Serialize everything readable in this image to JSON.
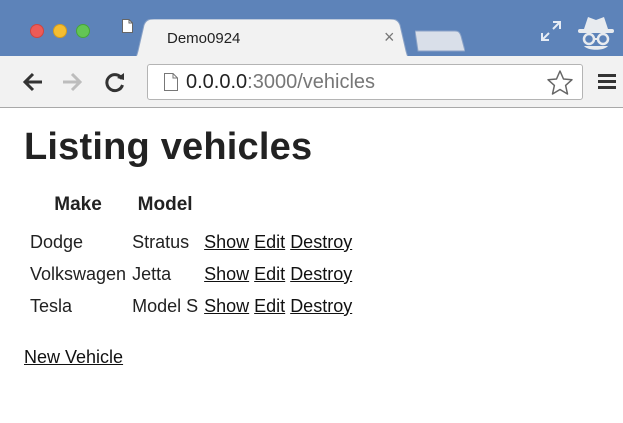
{
  "tab": {
    "title": "Demo0924",
    "close": "×"
  },
  "address_bar": {
    "host": "0.0.0.0",
    "rest": ":3000/vehicles"
  },
  "page": {
    "title": "Listing vehicles",
    "table": {
      "headers": [
        "Make",
        "Model"
      ],
      "rows": [
        {
          "make": "Dodge",
          "model": "Stratus",
          "show": "Show",
          "edit": "Edit",
          "destroy": "Destroy"
        },
        {
          "make": "Volkswagen",
          "model": "Jetta",
          "show": "Show",
          "edit": "Edit",
          "destroy": "Destroy"
        },
        {
          "make": "Tesla",
          "model": "Model S",
          "show": "Show",
          "edit": "Edit",
          "destroy": "Destroy"
        }
      ]
    },
    "new_link": "New Vehicle"
  },
  "icons": [
    "close-window-icon",
    "minimize-window-icon",
    "maximize-window-icon",
    "page-icon",
    "fullscreen-icon",
    "incognito-icon",
    "back-icon",
    "forward-icon",
    "reload-icon",
    "star-icon",
    "menu-icon"
  ],
  "colors": {
    "titlebar": "#5d83b9",
    "toolbar": "#f2f2f2",
    "text": "#222222"
  }
}
